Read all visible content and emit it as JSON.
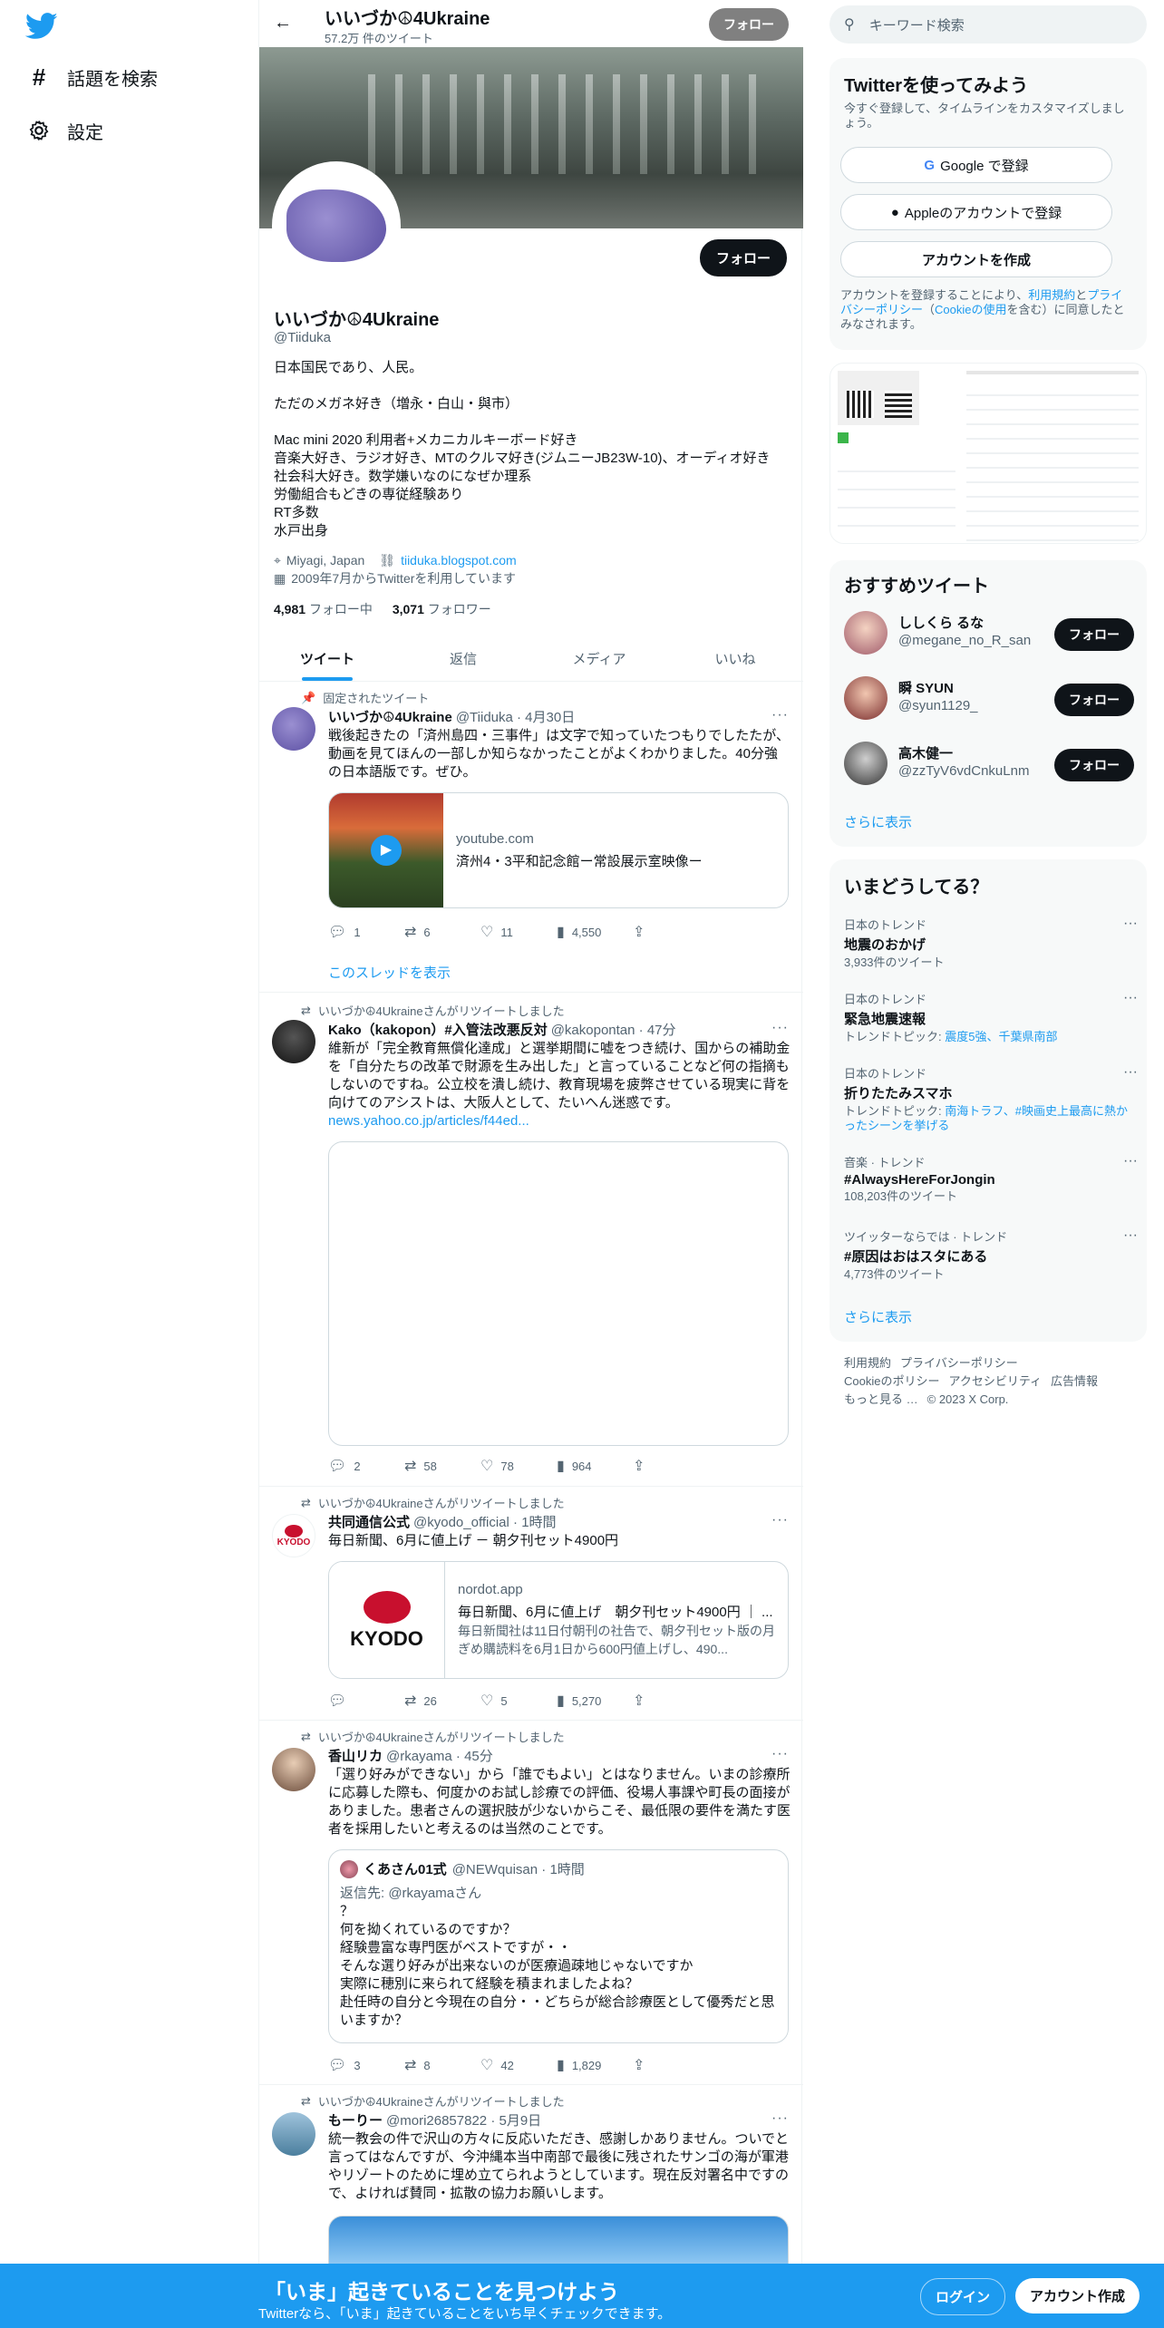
{
  "nav": {
    "explore_label": "話題を検索",
    "settings_label": "設定"
  },
  "profile": {
    "name": "いいづか☮4Ukraine",
    "tweet_count": "57.2万 件のツイート",
    "topbar_follow": "フォロー",
    "follow_button": "フォロー",
    "handle": "@Tiiduka",
    "bio": "日本国民であり、人民。\n\nただのメガネ好き（増永・白山・與市）\n\nMac mini 2020 利用者+メカニカルキーボード好き\n音楽大好き、ラジオ好き、MTのクルマ好き(ジムニーJB23W-10)、オーディオ好き\n社会科大好き。数学嫌いなのになぜか理系\n労働組合もどきの専従経験あり\nRT多数\n水戸出身",
    "location": "Miyagi, Japan",
    "website": "tiiduka.blogspot.com",
    "joined": "2009年7月からTwitterを利用しています",
    "following_num": "4,981",
    "following_label": "フォロー中",
    "followers_num": "3,071",
    "followers_label": "フォロワー"
  },
  "tabs": [
    {
      "label": "ツイート"
    },
    {
      "label": "返信"
    },
    {
      "label": "メディア"
    },
    {
      "label": "いいね"
    }
  ],
  "tweets": [
    {
      "context": "固定されたツイート",
      "name": "いいづか☮4Ukraine",
      "meta": "@Tiiduka · 4月30日",
      "text": "戦後起きたの「済州島四・三事件」は文字で知っていたつもりでしたたが、動画を見てほんの一部しか知らなかったことがよくわかりました。40分強の日本語版です。ぜひ。",
      "card_domain": "youtube.com",
      "card_title": "済州4・3平和記念館ー常設展示室映像ー",
      "replies": "1",
      "retweets": "6",
      "likes": "11",
      "views": "4,550",
      "show_thread": "このスレッドを表示"
    },
    {
      "context": "いいづか☮4Ukraineさんがリツイートしました",
      "name": "Kako（kakopon）#入管法改悪反対",
      "meta": "@kakopontan · 47分",
      "text": "維新が「完全教育無償化達成」と選挙期間に嘘をつき続け、国からの補助金を「自分たちの改革で財源を生み出した」と言っていることなど何の指摘もしないのですね。公立校を潰し続け、教育現場を疲弊させている現実に背を向けてのアシストは、大阪人として、たいへん迷惑です。",
      "link": "news.yahoo.co.jp/articles/f44ed...",
      "replies": "2",
      "retweets": "58",
      "likes": "78",
      "views": "964"
    },
    {
      "context": "いいづか☮4Ukraineさんがリツイートしました",
      "name": "共同通信公式",
      "meta": "@kyodo_official · 1時間",
      "text": "毎日新聞、6月に値上げ － 朝夕刊セット4900円",
      "card_domain": "nordot.app",
      "card_title": "毎日新聞、6月に値上げ　朝夕刊セット4900円 ｜ ...",
      "card_desc": "毎日新聞社は11日付朝刊の社告で、朝夕刊セット版の月ぎめ購読料を6月1日から600円値上げし、490...",
      "card_logo": "KYODO",
      "replies": "",
      "retweets": "26",
      "likes": "5",
      "views": "5,270"
    },
    {
      "context": "いいづか☮4Ukraineさんがリツイートしました",
      "name": "香山リカ",
      "meta": "@rkayama · 45分",
      "text": "「選り好みができない」から「誰でもよい」とはなりません。いまの診療所に応募した際も、何度かのお試し診療での評価、役場人事課や町長の面接がありました。患者さんの選択肢が少ないからこそ、最低限の要件を満たす医者を採用したいと考えるのは当然のことです。",
      "quote_name": "くあさん01式",
      "quote_meta": "@NEWquisan · 1時間",
      "quote_reply_to": "返信先: @rkayamaさん",
      "quote_text": "？\n何を拗くれているのですか？\n経験豊富な専門医がベストですが・・\nそんな選り好みが出来ないのが医療過疎地じゃないですか\n実際に穂別に来られて経験を積まれましたよね？\n赴任時の自分と今現在の自分・・どちらが総合診療医として優秀だと思いますか？",
      "replies": "3",
      "retweets": "8",
      "likes": "42",
      "views": "1,829"
    },
    {
      "context": "いいづか☮4Ukraineさんがリツイートしました",
      "name": "もーりー",
      "meta": "@mori26857822 · 5月9日",
      "text": "統一教会の件で沢山の方々に反応いただき、感謝しかありません。ついでと言ってはなんですが、今沖縄本当中南部で最後に残されたサンゴの海が軍港やリゾートのために埋め立てられようとしています。現在反対署名中ですので、よければ賛同・拡散の協力お願いします。"
    }
  ],
  "right": {
    "search_placeholder": "キーワード検索",
    "join_title": "Twitterを使ってみよう",
    "join_sub": "今すぐ登録して、タイムラインをカスタマイズしましょう。",
    "google_btn": "Google で登録",
    "apple_btn": "Appleのアカウントで登録",
    "create_btn": "アカウントを作成",
    "join_note_1": "アカウントを登録することにより、",
    "join_note_terms": "利用規約",
    "join_note_2": "と",
    "join_note_privacy": "プライバシーポリシー",
    "join_note_3": "（",
    "join_note_cookie": "Cookieの使用",
    "join_note_4": "を含む）に同意したとみなされます。",
    "rec_title": "おすすめツイート",
    "recs": [
      {
        "name": "ししくら るな",
        "handle": "@megane_no_R_san",
        "btn": "フォロー"
      },
      {
        "name": "瞬 SYUN",
        "handle": "@syun1129_",
        "btn": "フォロー"
      },
      {
        "name": "高木健一",
        "handle": "@zzTyV6vdCnkuLnm",
        "btn": "フォロー"
      }
    ],
    "rec_more": "さらに表示",
    "trend_title": "いまどうしてる？",
    "trends": [
      {
        "cat": "日本のトレンド",
        "title": "地震のおかげ",
        "sub": "3,933件のツイート"
      },
      {
        "cat": "日本のトレンド",
        "title": "緊急地震速報",
        "sub_prefix": "トレンドトピック: ",
        "sub_link": "震度5強、千葉県南部"
      },
      {
        "cat": "日本のトレンド",
        "title": "折りたたみスマホ",
        "sub_prefix": "トレンドトピック: ",
        "sub_link": "南海トラフ、#映画史上最高に熱かったシーンを挙げる"
      },
      {
        "cat": "音楽 · トレンド",
        "title": "#AlwaysHereForJongin",
        "sub": "108,203件のツイート"
      },
      {
        "cat": "ツイッターならでは · トレンド",
        "title": "#原因はおはスタにある",
        "sub": "4,773件のツイート"
      }
    ],
    "trend_more": "さらに表示",
    "footer": [
      "利用規約",
      "プライバシーポリシー",
      "Cookieのポリシー",
      "アクセシビリティ",
      "広告情報",
      "もっと見る …",
      "© 2023 X Corp."
    ]
  },
  "bottombar": {
    "title": "「いま」起きていることを見つけよう",
    "sub": "Twitterなら、「いま」起きていることをいち早くチェックできます。",
    "login": "ログイン",
    "signup": "アカウント作成"
  },
  "colors": {
    "accent": "#1d9bf0",
    "text": "#0f1419",
    "muted": "#536471"
  }
}
